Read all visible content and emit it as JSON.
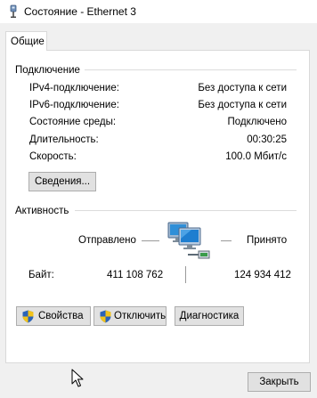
{
  "window": {
    "title": "Состояние - Ethernet 3"
  },
  "tabs": [
    {
      "label": "Общие"
    }
  ],
  "connection": {
    "group_title": "Подключение",
    "rows": [
      {
        "label": "IPv4-подключение:",
        "value": "Без доступа к сети"
      },
      {
        "label": "IPv6-подключение:",
        "value": "Без доступа к сети"
      },
      {
        "label": "Состояние среды:",
        "value": "Подключено"
      },
      {
        "label": "Длительность:",
        "value": "00:30:25"
      },
      {
        "label": "Скорость:",
        "value": "100.0 Мбит/с"
      }
    ],
    "details_button": "Сведения..."
  },
  "activity": {
    "group_title": "Активность",
    "sent_label": "Отправлено",
    "received_label": "Принято",
    "bytes_label": "Байт:",
    "bytes_sent": "411 108 762",
    "bytes_received": "124 934 412"
  },
  "buttons": {
    "properties": "Свойства",
    "disable": "Отключить",
    "diagnose": "Диагностика",
    "close": "Закрыть"
  },
  "icons": {
    "title": "network-adapter-icon",
    "shield": "uac-shield-icon",
    "activity": "network-computers-icon",
    "cursor": "mouse-pointer-icon"
  },
  "colors": {
    "window_bg": "#f0f0f0",
    "panel_bg": "#ffffff",
    "button_bg": "#e1e1e1",
    "button_border": "#adadad",
    "shield_blue": "#2b63b8",
    "shield_yellow": "#f2c31b"
  }
}
